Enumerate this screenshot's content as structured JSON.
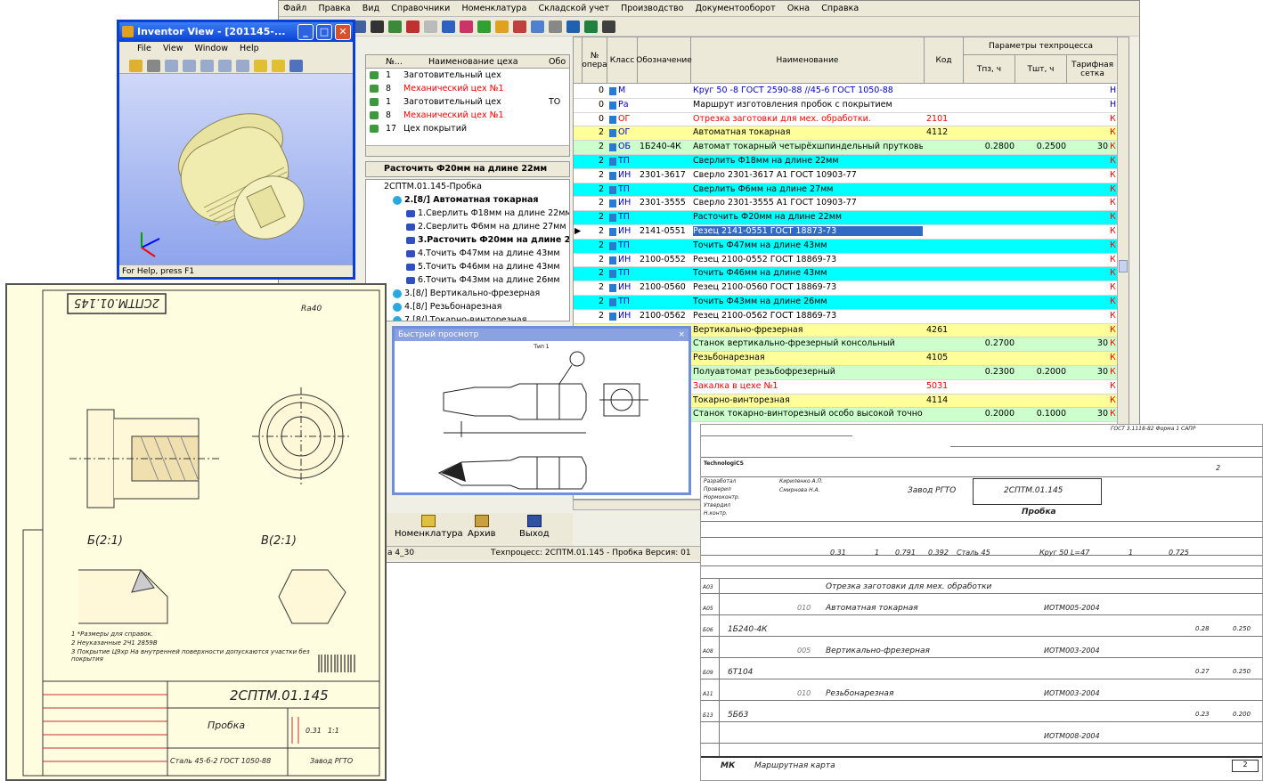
{
  "main_window": {
    "menu": [
      "Файл",
      "Правка",
      "Вид",
      "Справочники",
      "Номенклатура",
      "Складской учет",
      "Производство",
      "Документооборот",
      "Окна",
      "Справка"
    ],
    "workshop_tree": {
      "headers": [
        "№...",
        "Наименование цеха",
        "Обо"
      ],
      "rows": [
        {
          "num": "1",
          "name": "Заготовительный цех",
          "code": "",
          "color": "black"
        },
        {
          "num": "8",
          "name": "Механический цех №1",
          "code": "",
          "color": "red"
        },
        {
          "num": "1",
          "name": "Заготовительный цех",
          "code": "ТО",
          "color": "black"
        },
        {
          "num": "8",
          "name": "Механический цех №1",
          "code": "",
          "color": "red"
        },
        {
          "num": "17",
          "name": "Цех покрытий",
          "code": "",
          "color": "black"
        }
      ]
    },
    "operation_title": "Расточить Ф20мм на длине 22мм",
    "op_tree": {
      "root": "2СПТМ.01.145-Пробка",
      "operation": "2.[8/] Автоматная токарная",
      "steps": [
        "1.Сверлить Ф18мм на длине 22мм",
        "2.Сверлить Ф6мм на длине 27мм",
        "3.Расточить Ф20мм на длине 22мм",
        "4.Точить Ф47мм на длине 43мм",
        "5.Точить Ф46мм на длине 43мм",
        "6.Точить Ф43мм на длине 26мм"
      ],
      "others": [
        "3.[8/] Вертикально-фрезерная",
        "4.[8/] Резьбонарезная",
        "7.[8/] Токарно-винторезная"
      ]
    },
    "bottom_buttons": [
      "Номенклатура",
      "Архив",
      "Выход"
    ],
    "status_left": "а 4_30",
    "status_right": "Техпроцесс: 2СПТМ.01.145 - Пробка Версия: 01",
    "grid": {
      "headers": {
        "num": "№ опера",
        "cls": "Класс",
        "obozn": "Обозначение",
        "name": "Наименование",
        "code": "Код",
        "params": "Параметры техпроцесса",
        "tpz": "Тпз, ч",
        "tsht": "Тшт, ч",
        "tarif": "Тарифная сетка"
      },
      "rows": [
        {
          "n": "0",
          "cls": "М",
          "obozn": "",
          "name": "Круг 50 -8 ГОСТ 2590-88 //45-6 ГОСТ 1050-88",
          "code": "",
          "tpz": "",
          "tsht": "",
          "tar": "",
          "end": "Н",
          "bg": "w",
          "col": "blue"
        },
        {
          "n": "0",
          "cls": "Ра",
          "obozn": "",
          "name": "Маршрут изготовления пробок с покрытием",
          "code": "",
          "tpz": "",
          "tsht": "",
          "tar": "",
          "end": "Н",
          "bg": "w",
          "col": "black"
        },
        {
          "n": "0",
          "cls": "ОГ",
          "obozn": "",
          "name": "Отрезка заготовки для мех. обработки.",
          "code": "2101",
          "tpz": "",
          "tsht": "",
          "tar": "",
          "end": "К",
          "bg": "w",
          "col": "red"
        },
        {
          "n": "2",
          "cls": "ОГ",
          "obozn": "",
          "name": "Автоматная токарная",
          "code": "4112",
          "tpz": "",
          "tsht": "",
          "tar": "",
          "end": "К",
          "bg": "y",
          "col": "black"
        },
        {
          "n": "2",
          "cls": "ОБ",
          "obozn": "1Б240-4К",
          "name": "Автомат токарный четырёхшпиндельный прутковый",
          "code": "",
          "tpz": "0.2800",
          "tsht": "0.2500",
          "tar": "30",
          "end": "К",
          "bg": "g",
          "col": "black"
        },
        {
          "n": "2",
          "cls": "ТП",
          "obozn": "",
          "name": "Сверлить Ф18мм на длине 22мм",
          "code": "",
          "tpz": "",
          "tsht": "",
          "tar": "",
          "end": "К",
          "bg": "c",
          "col": "black"
        },
        {
          "n": "2",
          "cls": "ИН",
          "obozn": "2301-3617",
          "name": "Сверло 2301-3617 А1 ГОСТ 10903-77",
          "code": "",
          "tpz": "",
          "tsht": "",
          "tar": "",
          "end": "К",
          "bg": "w",
          "col": "black"
        },
        {
          "n": "2",
          "cls": "ТП",
          "obozn": "",
          "name": "Сверлить Ф6мм на длине 27мм",
          "code": "",
          "tpz": "",
          "tsht": "",
          "tar": "",
          "end": "К",
          "bg": "c",
          "col": "black"
        },
        {
          "n": "2",
          "cls": "ИН",
          "obozn": "2301-3555",
          "name": "Сверло 2301-3555 А1 ГОСТ 10903-77",
          "code": "",
          "tpz": "",
          "tsht": "",
          "tar": "",
          "end": "К",
          "bg": "w",
          "col": "black"
        },
        {
          "n": "2",
          "cls": "ТП",
          "obozn": "",
          "name": "Расточить Ф20мм на длине 22мм",
          "code": "",
          "tpz": "",
          "tsht": "",
          "tar": "",
          "end": "К",
          "bg": "c",
          "col": "black"
        },
        {
          "n": "2",
          "cls": "ИН",
          "obozn": "2141-0551",
          "name": "Резец 2141-0551 ГОСТ 18873-73",
          "code": "",
          "tpz": "",
          "tsht": "",
          "tar": "",
          "end": "К",
          "bg": "w",
          "col": "black",
          "selected": true
        },
        {
          "n": "2",
          "cls": "ТП",
          "obozn": "",
          "name": "Точить Ф47мм на длине 43мм",
          "code": "",
          "tpz": "",
          "tsht": "",
          "tar": "",
          "end": "К",
          "bg": "c",
          "col": "black"
        },
        {
          "n": "2",
          "cls": "ИН",
          "obozn": "2100-0552",
          "name": "Резец 2100-0552 ГОСТ 18869-73",
          "code": "",
          "tpz": "",
          "tsht": "",
          "tar": "",
          "end": "К",
          "bg": "w",
          "col": "black"
        },
        {
          "n": "2",
          "cls": "ТП",
          "obozn": "",
          "name": "Точить Ф46мм на длине 43мм",
          "code": "",
          "tpz": "",
          "tsht": "",
          "tar": "",
          "end": "К",
          "bg": "c",
          "col": "black"
        },
        {
          "n": "2",
          "cls": "ИН",
          "obozn": "2100-0560",
          "name": "Резец 2100-0560 ГОСТ 18869-73",
          "code": "",
          "tpz": "",
          "tsht": "",
          "tar": "",
          "end": "К",
          "bg": "w",
          "col": "black"
        },
        {
          "n": "2",
          "cls": "ТП",
          "obozn": "",
          "name": "Точить Ф43мм на длине 26мм",
          "code": "",
          "tpz": "",
          "tsht": "",
          "tar": "",
          "end": "К",
          "bg": "c",
          "col": "black"
        },
        {
          "n": "2",
          "cls": "ИН",
          "obozn": "2100-0562",
          "name": "Резец 2100-0562 ГОСТ 18869-73",
          "code": "",
          "tpz": "",
          "tsht": "",
          "tar": "",
          "end": "К",
          "bg": "w",
          "col": "black"
        },
        {
          "n": "",
          "cls": "",
          "obozn": "",
          "name": "Вертикально-фрезерная",
          "code": "4261",
          "tpz": "",
          "tsht": "",
          "tar": "",
          "end": "К",
          "bg": "y",
          "col": "black"
        },
        {
          "n": "",
          "cls": "",
          "obozn": "",
          "name": "Станок вертикально-фрезерный консольный",
          "code": "",
          "tpz": "0.2700",
          "tsht": "",
          "tar": "30",
          "end": "К",
          "bg": "g",
          "col": "black"
        },
        {
          "n": "",
          "cls": "",
          "obozn": "",
          "name": "Резьбонарезная",
          "code": "4105",
          "tpz": "",
          "tsht": "",
          "tar": "",
          "end": "К",
          "bg": "y",
          "col": "black"
        },
        {
          "n": "",
          "cls": "",
          "obozn": "",
          "name": "Полуавтомат резьбофрезерный",
          "code": "",
          "tpz": "0.2300",
          "tsht": "0.2000",
          "tar": "30",
          "end": "К",
          "bg": "g",
          "col": "black"
        },
        {
          "n": "",
          "cls": "",
          "obozn": "",
          "name": "Закалка в цехе №1",
          "code": "5031",
          "tpz": "",
          "tsht": "",
          "tar": "",
          "end": "К",
          "bg": "w",
          "col": "red"
        },
        {
          "n": "",
          "cls": "",
          "obozn": "",
          "name": "Токарно-винторезная",
          "code": "4114",
          "tpz": "",
          "tsht": "",
          "tar": "",
          "end": "К",
          "bg": "y",
          "col": "black"
        },
        {
          "n": "",
          "cls": "",
          "obozn": "",
          "name": "Станок токарно-винторезный особо высокой точности",
          "code": "",
          "tpz": "0.2000",
          "tsht": "0.1000",
          "tar": "30",
          "end": "К",
          "bg": "g",
          "col": "black"
        }
      ]
    }
  },
  "inventor": {
    "title": "Inventor View - [201145-...",
    "menu": [
      "File",
      "View",
      "Window",
      "Help"
    ],
    "status": "For Help, press F1"
  },
  "quick_view": {
    "title": "Быстрый просмотр",
    "subtitle": "Тип 1"
  },
  "drawing": {
    "title_stamp": "2СПТМ.01.145",
    "name": "Пробка",
    "material": "Сталь 45-б-2 ГОСТ 1050-88",
    "org": "Завод РГТО",
    "mass": "0.31",
    "scale": "1:1",
    "roughness": "Ra40",
    "section_b": "Б(2:1)",
    "section_v": "В(2:1)",
    "notes": [
      "1 *Размеры для справок.",
      "2 Неуказанные 2Ч1 2859В",
      "3 Покрытие Ц9хр На внутренней поверхности допускаются участки без покрытия"
    ]
  },
  "route_card": {
    "gost": "ГОСТ 3.1118-82 Форма 1 САПР",
    "system": "TechnologiCS",
    "org": "Завод РГТО",
    "code": "2СПТМ.01.145",
    "part": "Пробка",
    "sheet": "2",
    "material": "Круг 50 L=47",
    "steel": "Сталь 45",
    "card_type": "МК",
    "card_name": "Маршрутная карта",
    "roles": [
      "Разработал",
      "Проверил",
      "Нормоконтр.",
      "Утвердил",
      "Н.контр."
    ],
    "people": [
      "Кириленко А.П.",
      "Смирнова Н.А."
    ],
    "vals": [
      "0.31",
      "1",
      "0.791",
      "0.392",
      "1",
      "0.725"
    ],
    "ops": [
      {
        "row": "А03",
        "text": "Отрезка заготовки для мех. обработки",
        "doc": ""
      },
      {
        "row": "А05",
        "num": "010",
        "text": "Автоматная токарная",
        "doc": "ИОТМ005-2004"
      },
      {
        "row": "Б06",
        "text": "1Б240-4К",
        "t1": "0.28",
        "t2": "0.250"
      },
      {
        "row": "А08",
        "num": "005",
        "text": "Вертикально-фрезерная",
        "doc": "ИОТМ003-2004"
      },
      {
        "row": "Б09",
        "text": "6Т104",
        "t1": "0.27",
        "t2": "0.250"
      },
      {
        "row": "А11",
        "num": "010",
        "text": "Резьбонарезная",
        "doc": "ИОТМ003-2004"
      },
      {
        "row": "Б13",
        "text": "5Б63",
        "t1": "0.23",
        "t2": "0.200"
      },
      {
        "row": "",
        "text": "",
        "doc": "ИОТМ008-2004"
      }
    ]
  },
  "colors": {
    "yellow": "#ffff99",
    "green": "#ccffcc",
    "cyan": "#00ffff",
    "red": "#ff0000",
    "xp_blue": "#0a3fd6",
    "selection": "#316ac5"
  }
}
